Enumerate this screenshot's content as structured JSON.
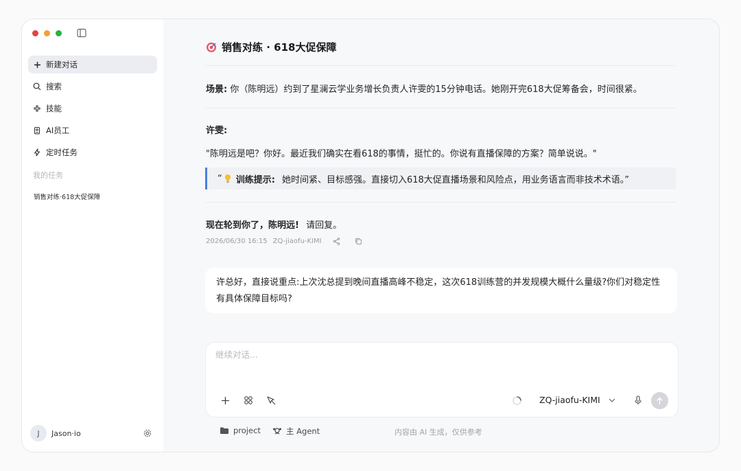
{
  "sidebar": {
    "items": [
      {
        "label": "新建对话",
        "icon": "plus-icon"
      },
      {
        "label": "搜索",
        "icon": "search-icon"
      },
      {
        "label": "技能",
        "icon": "skills-icon"
      },
      {
        "label": "AI员工",
        "icon": "ai-employee-icon"
      },
      {
        "label": "定时任务",
        "icon": "lightning-icon"
      }
    ],
    "section_label": "我的任务",
    "task": "销售对练·618大促保障",
    "user": {
      "initial": "J",
      "name": "Jason·io"
    }
  },
  "chat": {
    "title_icon": "target-icon",
    "title": "销售对练 · 618大促保障",
    "scene_label": "场景:",
    "scene_text": "你（陈明远）约到了星澜云学业务增长负责人许雯的15分钟电话。她刚开完618大促筹备会，时间很紧。",
    "speaker": "许雯:",
    "quote": "\"陈明远是吧？你好。最近我们确实在看618的事情，挺忙的。你说有直播保障的方案？简单说说。\"",
    "hint_open": "“",
    "hint_label": "训练提示:",
    "hint_text": "她时间紧、目标感强。直接切入618大促直播场景和风险点，用业务语言而非技术术语。”",
    "turn_bold": "现在轮到你了，陈明远!",
    "turn_text": "请回复。",
    "timestamp": "2026/06/30 16:15",
    "model_tag": "ZQ-jiaofu-KIMI",
    "user_message": "许总好，直接说重点:上次沈总提到晚间直播高峰不稳定，这次618训练营的并发规模大概什么量级?你们对稳定性有具体保障目标吗?"
  },
  "composer": {
    "placeholder": "继续对话...",
    "model": "ZQ-jiaofu-KIMI"
  },
  "footer": {
    "project": "project",
    "agent": "主 Agent",
    "disclaimer": "内容由 AI 生成，仅供参考"
  },
  "colors": {
    "accent_bar": "#4a7fe0",
    "traffic_red": "#e0443e",
    "traffic_yellow": "#f0a233",
    "traffic_green": "#27b33f"
  }
}
